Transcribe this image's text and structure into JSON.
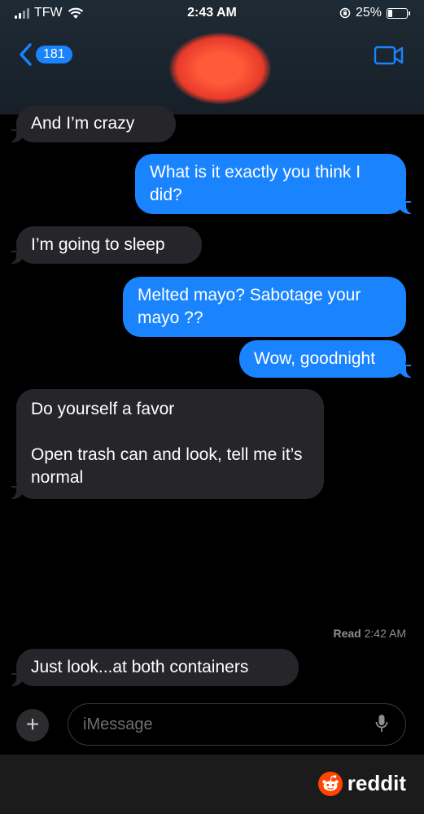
{
  "status_bar": {
    "carrier": "TFW",
    "time": "2:43 AM",
    "battery_percent": "25%"
  },
  "nav": {
    "back_badge": "181"
  },
  "messages": [
    {
      "direction": "in",
      "text": "And I’m crazy"
    },
    {
      "direction": "out",
      "text": "What is it exactly you think I did?"
    },
    {
      "direction": "in",
      "text": "I’m going to sleep"
    },
    {
      "direction": "out",
      "text": "Melted mayo? Sabotage your mayo ??"
    },
    {
      "direction": "out",
      "text": "Wow, goodnight"
    },
    {
      "direction": "in",
      "text": "Do yourself a favor"
    },
    {
      "direction": "in",
      "text": "Open trash can and look, tell me it’s normal"
    },
    {
      "direction": "in",
      "text": "Just look...at both containers"
    }
  ],
  "read_receipt": {
    "label": "Read",
    "time": "2:42 AM"
  },
  "compose": {
    "placeholder": "iMessage"
  },
  "footer": {
    "brand": "reddit"
  },
  "colors": {
    "outgoing": "#1a84ff",
    "incoming": "#26252a",
    "reddit_orange": "#ff4500"
  },
  "icons": [
    "signal-icon",
    "wifi-icon",
    "rotation-lock-icon",
    "battery-icon",
    "back-chevron-icon",
    "video-camera-icon",
    "plus-icon",
    "microphone-icon",
    "reddit-logo-icon"
  ]
}
